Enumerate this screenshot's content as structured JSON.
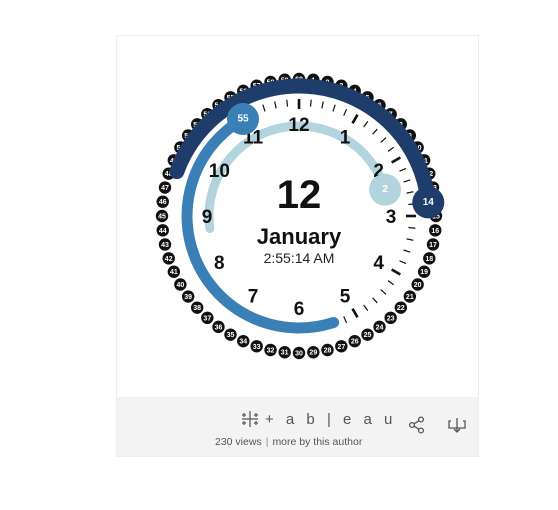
{
  "clock": {
    "day": "12",
    "month": "January",
    "time": "2:55:14 AM",
    "hour_value": 2,
    "minute_value": 55,
    "second_value": 14,
    "hour_badge": "2",
    "minute_badge": "55",
    "second_badge": "14",
    "hour_numbers": [
      "12",
      "1",
      "2",
      "3",
      "4",
      "5",
      "6",
      "7",
      "8",
      "9",
      "10",
      "11"
    ],
    "colors": {
      "seconds": "#1f3d6b",
      "minutes": "#3a7fb5",
      "hours": "#b3d4dd",
      "dot": "#111111"
    }
  },
  "footer": {
    "logo_text": "+ a b | e a u",
    "views": "230 views",
    "separator": "|",
    "more_link": "more by this author",
    "share_icon": "share-icon",
    "download_icon": "download-icon"
  }
}
